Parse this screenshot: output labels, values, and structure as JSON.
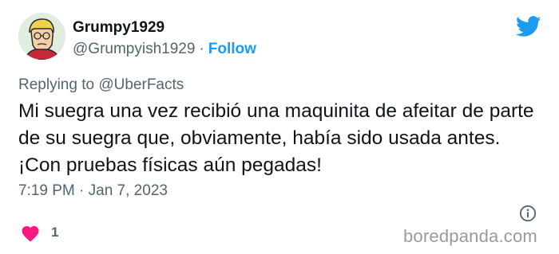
{
  "author": {
    "display_name": "Grumpy1929",
    "handle": "@Grumpyish1929",
    "separator": "·",
    "follow_label": "Follow"
  },
  "reply": {
    "prefix": "Replying to",
    "mention": "@UberFacts"
  },
  "tweet": {
    "text": "Mi suegra una vez recibió una maquinita de afeitar de parte de su suegra que, obviamente, había sido usada antes. ¡Con pruebas físicas aún pegadas!",
    "timestamp": "7:19 PM · Jan 7, 2023"
  },
  "engagement": {
    "likes": "1"
  },
  "watermark": "boredpanda.com",
  "icons": {
    "brand": "twitter-bird-icon",
    "like": "heart-icon",
    "info": "info-icon"
  },
  "colors": {
    "link": "#1d9bf0",
    "secondary_text": "#536471",
    "like": "#f91880",
    "twitter_blue": "#1d9bf0"
  }
}
